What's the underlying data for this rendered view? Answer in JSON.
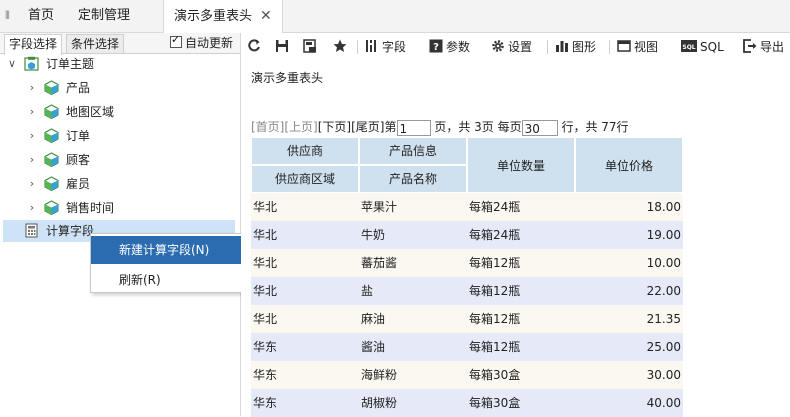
{
  "top_tabs": {
    "home": "首页",
    "custom": "定制管理",
    "active": "演示多重表头"
  },
  "left_tabs": {
    "field_select": "字段选择",
    "condition_select": "条件选择",
    "auto_refresh": "自动更新"
  },
  "tree": {
    "root": "订单主题",
    "items": [
      "产品",
      "地图区域",
      "订单",
      "顾客",
      "雇员",
      "销售时间"
    ],
    "calc": "计算字段"
  },
  "context_menu": {
    "new_calc": "新建计算字段(N)",
    "refresh": "刷新(R)"
  },
  "toolbar": {
    "field": "字段",
    "param": "参数",
    "settings": "设置",
    "chart": "图形",
    "view": "视图",
    "sql": "SQL",
    "export": "导出"
  },
  "report": {
    "title": "演示多重表头"
  },
  "pager": {
    "first": "[首页]",
    "prev": "[上页]",
    "next": "[下页]",
    "last": "[尾页]",
    "page_prefix": "第",
    "page_value": "1",
    "page_mid": "页，共 3页 每页",
    "per_page_value": "30",
    "suffix": "行，共 77行"
  },
  "table": {
    "headers": {
      "supplier": "供应商",
      "product_info": "产品信息",
      "unit_qty": "单位数量",
      "unit_price": "单位价格",
      "supplier_region": "供应商区域",
      "product_name": "产品名称"
    },
    "rows": [
      [
        "华北",
        "苹果汁",
        "每箱24瓶",
        "18.00"
      ],
      [
        "华北",
        "牛奶",
        "每箱24瓶",
        "19.00"
      ],
      [
        "华北",
        "蕃茄酱",
        "每箱12瓶",
        "10.00"
      ],
      [
        "华北",
        "盐",
        "每箱12瓶",
        "22.00"
      ],
      [
        "华北",
        "麻油",
        "每箱12瓶",
        "21.35"
      ],
      [
        "华东",
        "酱油",
        "每箱12瓶",
        "25.00"
      ],
      [
        "华东",
        "海鲜粉",
        "每箱30盒",
        "30.00"
      ],
      [
        "华东",
        "胡椒粉",
        "每箱30盒",
        "40.00"
      ]
    ]
  },
  "colors": {
    "header_bg": "#cfe0ef",
    "row_odd": "#fbf8f1",
    "row_even": "#e6eaf8",
    "menu_highlight": "#2b6cb0",
    "tree_selected": "#cfe3f7"
  }
}
